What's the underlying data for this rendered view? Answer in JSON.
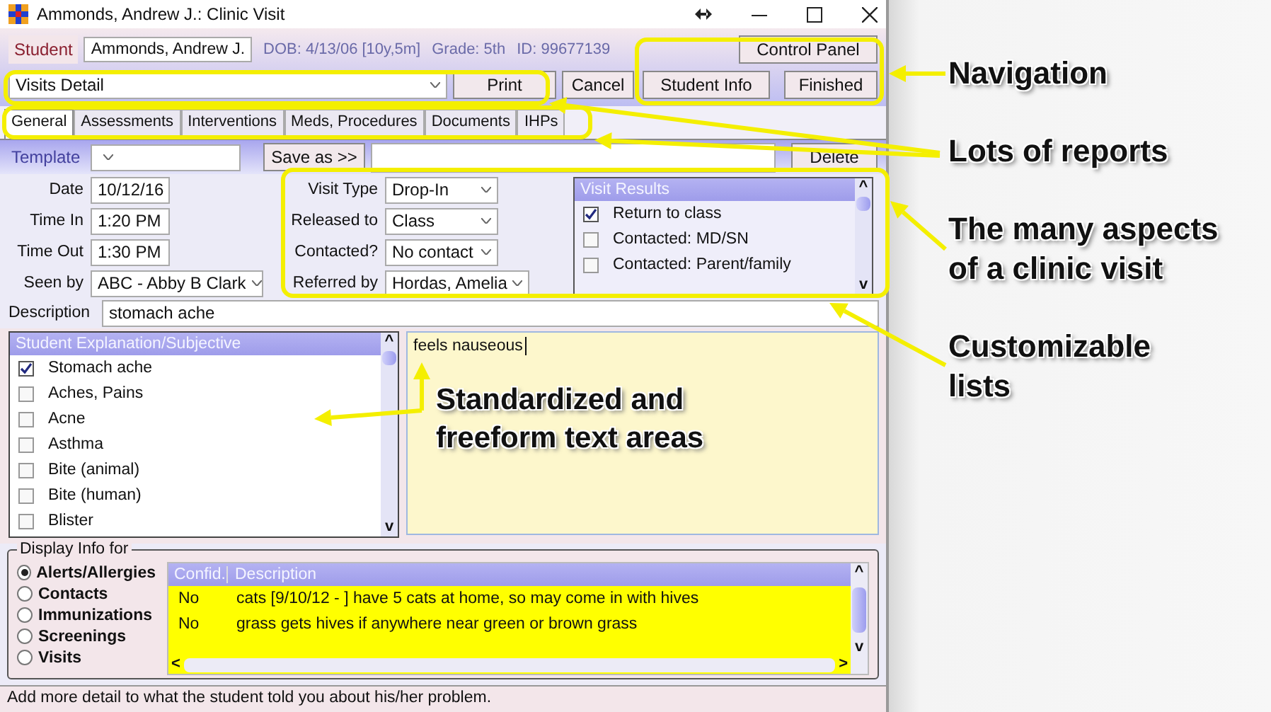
{
  "window": {
    "title": "Ammonds, Andrew J.: Clinic Visit"
  },
  "student": {
    "label": "Student",
    "name": "Ammonds, Andrew J.",
    "dob": "DOB: 4/13/06 [10y,5m]",
    "grade": "Grade: 5th",
    "id": "ID: 99677139"
  },
  "report": {
    "value": "Visits Detail"
  },
  "buttons": {
    "control_panel": "Control Panel",
    "print": "Print",
    "cancel": "Cancel",
    "student_info": "Student Info",
    "finished": "Finished",
    "save_as": "Save as >>",
    "delete": "Delete"
  },
  "tabs": [
    {
      "label": "General",
      "selected": true
    },
    {
      "label": "Assessments",
      "selected": false
    },
    {
      "label": "Interventions",
      "selected": false
    },
    {
      "label": "Meds, Procedures",
      "selected": false
    },
    {
      "label": "Documents",
      "selected": false
    },
    {
      "label": "IHPs",
      "selected": false
    }
  ],
  "template": {
    "label": "Template"
  },
  "visit_fields_left": [
    {
      "label": "Date",
      "value": "10/12/16",
      "kind": "text"
    },
    {
      "label": "Time In",
      "value": "1:20 PM",
      "kind": "text"
    },
    {
      "label": "Time Out",
      "value": "1:30 PM",
      "kind": "text"
    },
    {
      "label": "Seen by",
      "value": "ABC - Abby B Clark",
      "kind": "select"
    }
  ],
  "visit_fields_right": [
    {
      "label": "Visit Type",
      "value": "Drop-In",
      "kind": "select"
    },
    {
      "label": "Released to",
      "value": "Class",
      "kind": "select"
    },
    {
      "label": "Contacted?",
      "value": "No contact",
      "kind": "select"
    },
    {
      "label": "Referred by",
      "value": "Hordas, Amelia",
      "kind": "select"
    }
  ],
  "visit_results": {
    "title": "Visit Results",
    "scroll_up": "^",
    "scroll_down": "v",
    "items": [
      {
        "label": "Return to class",
        "checked": true
      },
      {
        "label": "Contacted: MD/SN",
        "checked": false
      },
      {
        "label": "Contacted: Parent/family",
        "checked": false
      }
    ]
  },
  "description": {
    "label": "Description",
    "value": "stomach ache"
  },
  "explanation": {
    "title": "Student Explanation/Subjective",
    "scroll_up": "^",
    "scroll_down": "v",
    "items": [
      {
        "label": "Stomach ache",
        "checked": true
      },
      {
        "label": "Aches, Pains",
        "checked": false
      },
      {
        "label": "Acne",
        "checked": false
      },
      {
        "label": "Asthma",
        "checked": false
      },
      {
        "label": "Bite (animal)",
        "checked": false
      },
      {
        "label": "Bite (human)",
        "checked": false
      },
      {
        "label": "Blister",
        "checked": false
      }
    ],
    "notes": "feels nauseous",
    "overlay_note": "Standardized and\nfreeform text areas"
  },
  "display_info": {
    "title": "Display Info for",
    "options": [
      {
        "label": "Alerts/Allergies",
        "selected": true
      },
      {
        "label": "Contacts",
        "selected": false
      },
      {
        "label": "Immunizations",
        "selected": false
      },
      {
        "label": "Screenings",
        "selected": false
      },
      {
        "label": "Visits",
        "selected": false
      }
    ],
    "table": {
      "columns": [
        "Confid.",
        "Description"
      ],
      "scroll_up": "^",
      "scroll_down": "v",
      "scroll_left": "<",
      "scroll_right": ">",
      "rows": [
        [
          "No",
          "cats [9/10/12 - ] have 5 cats at home, so may come in with hives"
        ],
        [
          "No",
          "grass gets hives if anywhere near green or brown grass"
        ]
      ]
    }
  },
  "status_bar": "Add more detail to what the student told you about his/her problem.",
  "callouts": [
    "Navigation",
    "Lots of reports",
    "The many aspects\nof a clinic visit",
    "Customizable\nlists"
  ]
}
